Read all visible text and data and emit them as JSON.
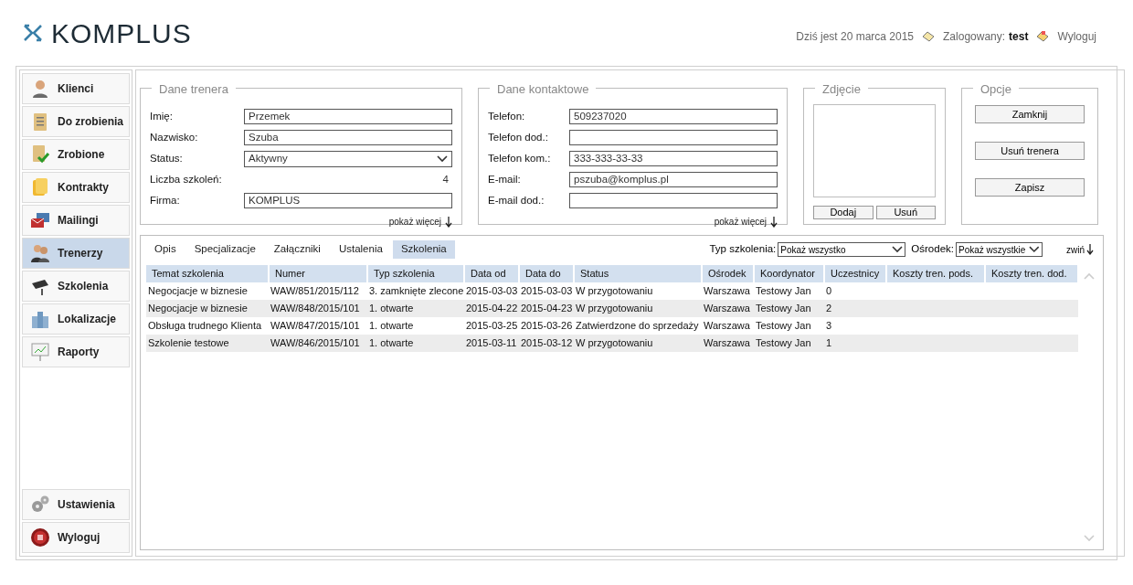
{
  "header": {
    "logo": "KOMPLUS",
    "date": "Dziś jest 20 marca 2015",
    "logged_label": "Zalogowany:",
    "user": "test",
    "logout": "Wyloguj"
  },
  "sidebar": {
    "items": [
      {
        "label": "Klienci",
        "selected": false
      },
      {
        "label": "Do zrobienia",
        "selected": false
      },
      {
        "label": "Zrobione",
        "selected": false
      },
      {
        "label": "Kontrakty",
        "selected": false
      },
      {
        "label": "Mailingi",
        "selected": false
      },
      {
        "label": "Trenerzy",
        "selected": true
      },
      {
        "label": "Szkolenia",
        "selected": false
      },
      {
        "label": "Lokalizacje",
        "selected": false
      },
      {
        "label": "Raporty",
        "selected": false
      }
    ],
    "bottom_items": [
      {
        "label": "Ustawienia",
        "selected": false
      },
      {
        "label": "Wyloguj",
        "selected": false
      }
    ]
  },
  "trainer": {
    "title": "Dane trenera",
    "fields": [
      {
        "kind": "input",
        "label": "Imię:",
        "value": "Przemek"
      },
      {
        "kind": "input",
        "label": "Nazwisko:",
        "value": "Szuba"
      },
      {
        "kind": "select",
        "label": "Status:",
        "value": "Aktywny"
      },
      {
        "kind": "text",
        "label": "Liczba szkoleń:",
        "value": "4"
      },
      {
        "kind": "input",
        "label": "Firma:",
        "value": "KOMPLUS"
      }
    ],
    "more": "pokaż więcej"
  },
  "contact": {
    "title": "Dane kontaktowe",
    "fields": [
      {
        "kind": "input",
        "label": "Telefon:",
        "value": "509237020"
      },
      {
        "kind": "input",
        "label": "Telefon dod.:"
      },
      {
        "kind": "input",
        "label": "Telefon kom.:",
        "value": "333-333-33-33"
      },
      {
        "kind": "input",
        "label": "E-mail:",
        "value": "pszuba@komplus.pl"
      },
      {
        "kind": "input",
        "label": "E-mail dod.:"
      }
    ],
    "more": "pokaż więcej"
  },
  "photo": {
    "title": "Zdjęcie",
    "buttons": [
      "Dodaj",
      "Usuń"
    ]
  },
  "options": {
    "title": "Opcje",
    "buttons": [
      "Zamknij",
      "Usuń trenera",
      "Zapisz"
    ]
  },
  "tabs": [
    {
      "label": "Opis",
      "selected": false
    },
    {
      "label": "Specjalizacje",
      "selected": false
    },
    {
      "label": "Załączniki",
      "selected": false
    },
    {
      "label": "Ustalenia",
      "selected": false
    },
    {
      "label": "Szkolenia",
      "selected": true
    }
  ],
  "filters": [
    {
      "label": "Typ szkolenia:",
      "value": "Pokaż wszystko"
    },
    {
      "label": "Ośrodek:",
      "value": "Pokaż wszystkie"
    }
  ],
  "collapse": "zwiń",
  "table": {
    "columns": [
      "Temat szkolenia",
      "Numer",
      "Typ szkolenia",
      "Data od",
      "Data do",
      "Status",
      "Ośrodek",
      "Koordynator",
      "Uczestnicy",
      "Koszty tren. pods.",
      "Koszty tren. dod."
    ],
    "rows": [
      [
        "Negocjacje w biznesie",
        "WAW/851/2015/112",
        "3. zamknięte zlecone",
        "2015-03-03",
        "2015-03-03",
        "W przygotowaniu",
        "Warszawa",
        "Testowy Jan",
        "0"
      ],
      [
        "Negocjacje w biznesie",
        "WAW/848/2015/101",
        "1. otwarte",
        "2015-04-22",
        "2015-04-23",
        "W przygotowaniu",
        "Warszawa",
        "Testowy Jan",
        "2"
      ],
      [
        "Obsługa trudnego Klienta",
        "WAW/847/2015/101",
        "1. otwarte",
        "2015-03-25",
        "2015-03-26",
        "Zatwierdzone do sprzedaży",
        "Warszawa",
        "Testowy Jan",
        "3"
      ],
      [
        "Szkolenie testowe",
        "WAW/846/2015/101",
        "1. otwarte",
        "2015-03-11",
        "2015-03-12",
        "W przygotowaniu",
        "Warszawa",
        "Testowy Jan",
        "1"
      ]
    ]
  }
}
